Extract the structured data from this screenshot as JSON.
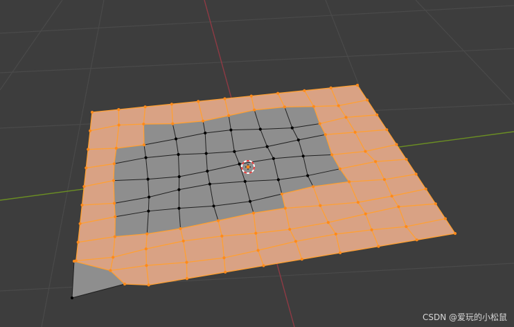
{
  "viewport": {
    "background": "#3d3d3d",
    "grid_line_color": "#4a4a4a",
    "x_axis_color": "#8f3a44",
    "y_axis_color": "#6b8e23"
  },
  "mesh": {
    "selected_face_fill": "#d9a284",
    "unselected_face_fill": "#8e8e8e",
    "selected_edge_color": "#ffa033",
    "unselected_edge_color": "#1f1f1f",
    "selected_vertex_color": "#ff8a1a",
    "unselected_vertex_color": "#000000"
  },
  "cursor_3d": {
    "ring_colors": [
      "#ffffff",
      "#e53b3b"
    ]
  },
  "watermark": {
    "text": "CSDN @爱玩的小松鼠"
  }
}
